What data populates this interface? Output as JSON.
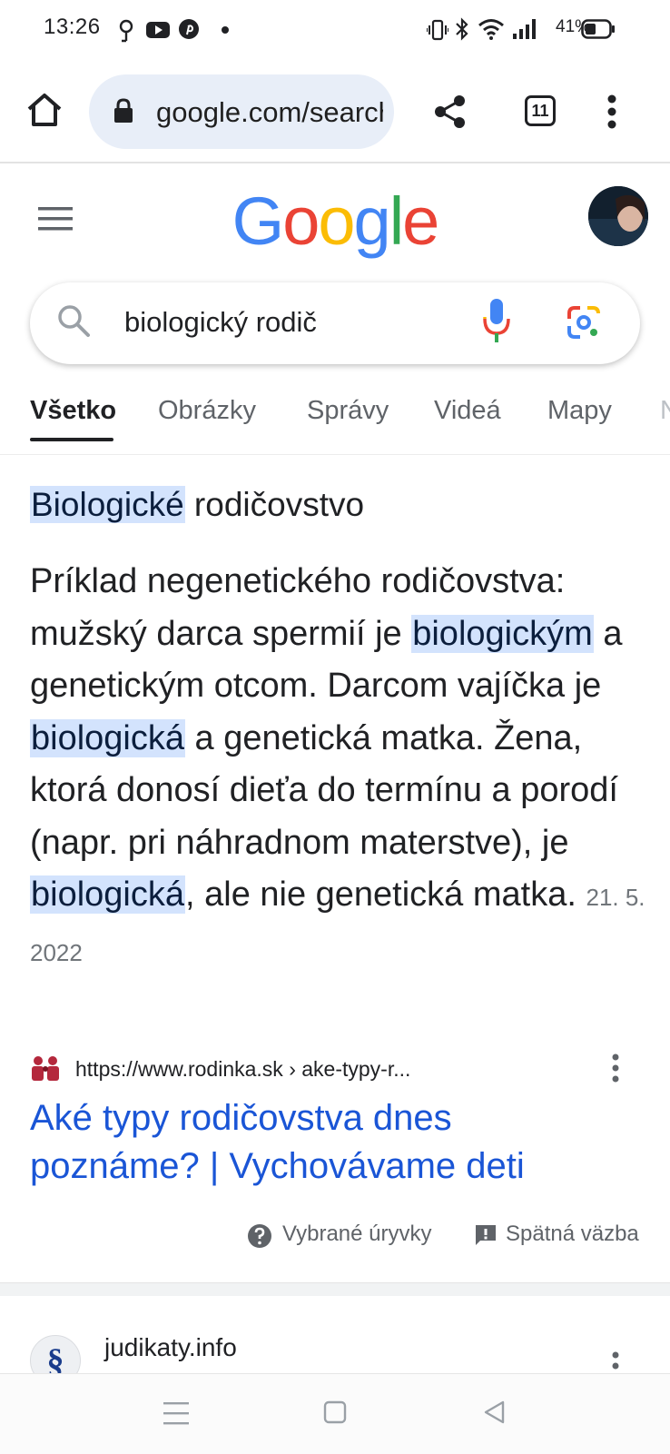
{
  "status_bar": {
    "time": "13:26",
    "battery_percent": "41%",
    "left_icons": [
      "location-pin-icon",
      "youtube-icon",
      "pinterest-icon",
      "dot-icon"
    ],
    "right_icons": [
      "vibrate-icon",
      "bluetooth-icon",
      "wifi-icon",
      "signal-icon",
      "battery-icon"
    ]
  },
  "browser": {
    "url": "google.com/search",
    "tab_count": "11"
  },
  "google": {
    "logo_letters": [
      "G",
      "o",
      "o",
      "g",
      "l",
      "e"
    ],
    "logo_colors": [
      "#4285F4",
      "#EA4335",
      "#FBBC05",
      "#4285F4",
      "#34A853",
      "#EA4335"
    ]
  },
  "search": {
    "query": "biologický rodič"
  },
  "tabs": [
    {
      "label": "Všetko",
      "active": true
    },
    {
      "label": "Obrázky",
      "active": false
    },
    {
      "label": "Správy",
      "active": false
    },
    {
      "label": "Videá",
      "active": false
    },
    {
      "label": "Mapy",
      "active": false
    },
    {
      "label": "N",
      "active": false
    }
  ],
  "snippet": {
    "title_highlight": "Biologické",
    "title_rest": " rodičovstvo",
    "parts": [
      "Príklad negenetického rodičovstva: mužský darca spermií je ",
      "biologickým",
      " a genetickým otcom. Darcom vajíčka je ",
      "biologická",
      " a genetická matka. Žena, ktorá donosí dieťa do termínu a porodí (napr. pri náhradnom materstve), je ",
      "biologická",
      ", ale nie genetická matka.  "
    ],
    "date": "21. 5. 2022"
  },
  "source": {
    "url": "https://www.rodinka.sk › ake-typy-r...",
    "title": "Aké typy rodičovstva dnes poznáme? | Vychovávame deti",
    "link_color": "#1a55d6"
  },
  "snippet_footer": {
    "about_label": "Vybrané úryvky",
    "feedback_label": "Spätná väzba"
  },
  "second_result": {
    "favicon_glyph": "§",
    "site": "judikaty.info"
  }
}
